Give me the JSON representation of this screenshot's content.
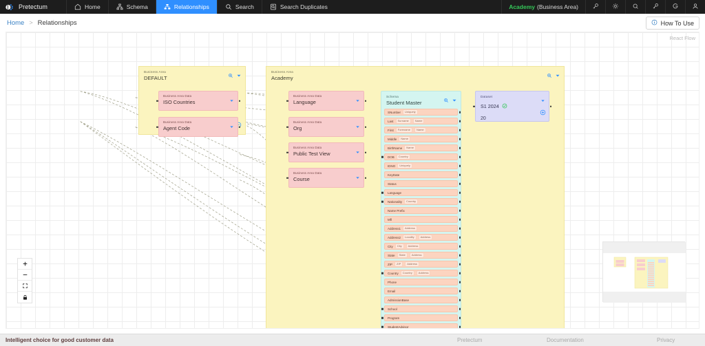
{
  "topnav": {
    "brand": "Pretectum",
    "items": [
      {
        "label": "Home",
        "icon": "home-icon",
        "active": false
      },
      {
        "label": "Schema",
        "icon": "schema-icon",
        "active": false
      },
      {
        "label": "Relationships",
        "icon": "relationships-icon",
        "active": true
      },
      {
        "label": "Search",
        "icon": "search-icon",
        "active": false
      },
      {
        "label": "Search Duplicates",
        "icon": "search-duplicates-icon",
        "active": false
      }
    ],
    "business_area": {
      "name": "Academy",
      "suffix": "(Business Area)",
      "color": "#35c759"
    },
    "right_icons": [
      "key-icon",
      "gear-icon",
      "magnifier-icon",
      "wrench-icon",
      "google-icon",
      "user-icon"
    ],
    "active_color": "#2f8fff"
  },
  "breadcrumb": {
    "home": "Home",
    "separator": ">",
    "current": "Relationships"
  },
  "howto": {
    "label": "How To Use",
    "icon": "info-icon"
  },
  "canvas": {
    "attribution": "React Flow",
    "controls": [
      "zoom-in",
      "zoom-out",
      "fit-view",
      "lock"
    ],
    "groups": [
      {
        "kind": "Business Area",
        "title": "DEFAULT"
      },
      {
        "kind": "Business Area",
        "title": "Academy"
      }
    ],
    "default_nodes": [
      {
        "kind": "Business Area Data",
        "title": "ISO Countries"
      },
      {
        "kind": "Business Area Data",
        "title": "Agent Code"
      }
    ],
    "academy_nodes": [
      {
        "kind": "Business Area Data",
        "title": "Language"
      },
      {
        "kind": "Business Area Data",
        "title": "Org"
      },
      {
        "kind": "Business Area Data",
        "title": "Public Test View"
      },
      {
        "kind": "Business Area Data",
        "title": "Course"
      }
    ],
    "schema": {
      "kind": "Schema",
      "title": "Student Master",
      "fields": [
        {
          "name": "SNumber",
          "tags": [
            "Uniquely"
          ],
          "left": false
        },
        {
          "name": "Last",
          "tags": [
            "Surname",
            "Name"
          ],
          "left": false
        },
        {
          "name": "First",
          "tags": [
            "Forename",
            "Name"
          ],
          "left": false
        },
        {
          "name": "Middle",
          "tags": [
            "Name"
          ],
          "left": false
        },
        {
          "name": "BirthName",
          "tags": [
            "Name"
          ],
          "left": false
        },
        {
          "name": "DOB",
          "tags": [
            "Country"
          ],
          "left": true
        },
        {
          "name": "IDNO",
          "tags": [
            "Uniquely"
          ],
          "left": false
        },
        {
          "name": "KeyDate",
          "tags": [],
          "left": false
        },
        {
          "name": "Status",
          "tags": [],
          "left": false
        },
        {
          "name": "Language",
          "tags": [],
          "left": true
        },
        {
          "name": "Nationality",
          "tags": [
            "Country"
          ],
          "left": true
        },
        {
          "name": "Name Prefix",
          "tags": [],
          "left": false
        },
        {
          "name": "Mfl",
          "tags": [],
          "left": false
        },
        {
          "name": "Address1",
          "tags": [
            "Address"
          ],
          "left": false
        },
        {
          "name": "Address2",
          "tags": [
            "Locality",
            "Address"
          ],
          "left": false
        },
        {
          "name": "City",
          "tags": [
            "City",
            "Address"
          ],
          "left": false
        },
        {
          "name": "State",
          "tags": [
            "State",
            "Address"
          ],
          "left": false
        },
        {
          "name": "ZIP",
          "tags": [
            "ZIP",
            "Address"
          ],
          "left": false
        },
        {
          "name": "Country",
          "tags": [
            "Country",
            "Address"
          ],
          "left": true
        },
        {
          "name": "Phone",
          "tags": [],
          "left": false
        },
        {
          "name": "Email",
          "tags": [],
          "left": false
        },
        {
          "name": "AdmissionBase",
          "tags": [],
          "left": false
        },
        {
          "name": "School",
          "tags": [],
          "left": true
        },
        {
          "name": "Program",
          "tags": [],
          "left": true
        },
        {
          "name": "StudentAdvisor",
          "tags": [],
          "left": true
        }
      ]
    },
    "dataset": {
      "kind": "Dataset",
      "title": "S1 2024",
      "status_icon": "check-circle-icon",
      "count": "20"
    }
  },
  "footer": {
    "tagline": "Intelligent choice for good customer data",
    "links": [
      "Pretectum",
      "Documentation",
      "Privacy"
    ]
  }
}
